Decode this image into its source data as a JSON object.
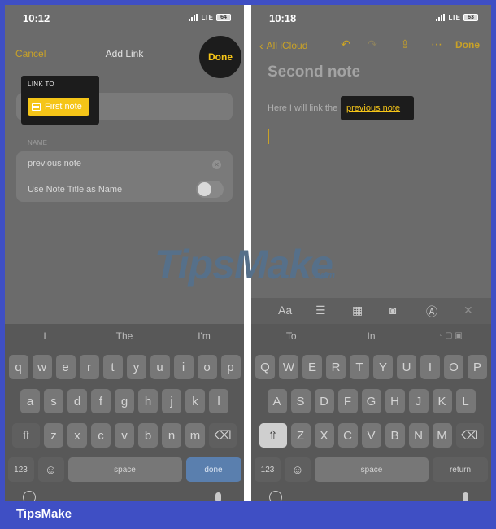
{
  "left": {
    "status": {
      "time": "10:12",
      "network": "LTE",
      "battery": "64"
    },
    "header": {
      "cancel": "Cancel",
      "title": "Add Link",
      "done": "Done"
    },
    "link_to": {
      "label": "LINK TO",
      "note": "First note"
    },
    "name": {
      "label": "NAME",
      "value": "previous note",
      "toggle_label": "Use Note Title as Name"
    },
    "keyboard": {
      "suggestions": [
        "I",
        "The",
        "I'm"
      ],
      "row1": [
        "q",
        "w",
        "e",
        "r",
        "t",
        "y",
        "u",
        "i",
        "o",
        "p"
      ],
      "row2": [
        "a",
        "s",
        "d",
        "f",
        "g",
        "h",
        "j",
        "k",
        "l"
      ],
      "row3": [
        "z",
        "x",
        "c",
        "v",
        "b",
        "n",
        "m"
      ],
      "shift": "⇧",
      "delete": "⌫",
      "numbers": "123",
      "emoji": "☺",
      "space": "space",
      "action": "done"
    }
  },
  "right": {
    "status": {
      "time": "10:18",
      "network": "LTE",
      "battery": "63"
    },
    "header": {
      "back": "All iCloud",
      "done": "Done"
    },
    "note": {
      "title": "Second note",
      "body_prefix": "Here I will link the ",
      "link": "previous note"
    },
    "toolbar": {
      "format": "Aa"
    },
    "keyboard": {
      "suggestions": [
        "To",
        "In"
      ],
      "row1": [
        "Q",
        "W",
        "E",
        "R",
        "T",
        "Y",
        "U",
        "I",
        "O",
        "P"
      ],
      "row2": [
        "A",
        "S",
        "D",
        "F",
        "G",
        "H",
        "J",
        "K",
        "L"
      ],
      "row3": [
        "Z",
        "X",
        "C",
        "V",
        "B",
        "N",
        "M"
      ],
      "shift": "⇧",
      "delete": "⌫",
      "numbers": "123",
      "emoji": "☺",
      "space": "space",
      "action": "return"
    }
  },
  "watermark": {
    "main": "TipsMake",
    "sub": ".com"
  },
  "footer": {
    "brand": "TipsMake"
  },
  "colors": {
    "frame": "#3f4fc4",
    "accent": "#f5c518"
  }
}
